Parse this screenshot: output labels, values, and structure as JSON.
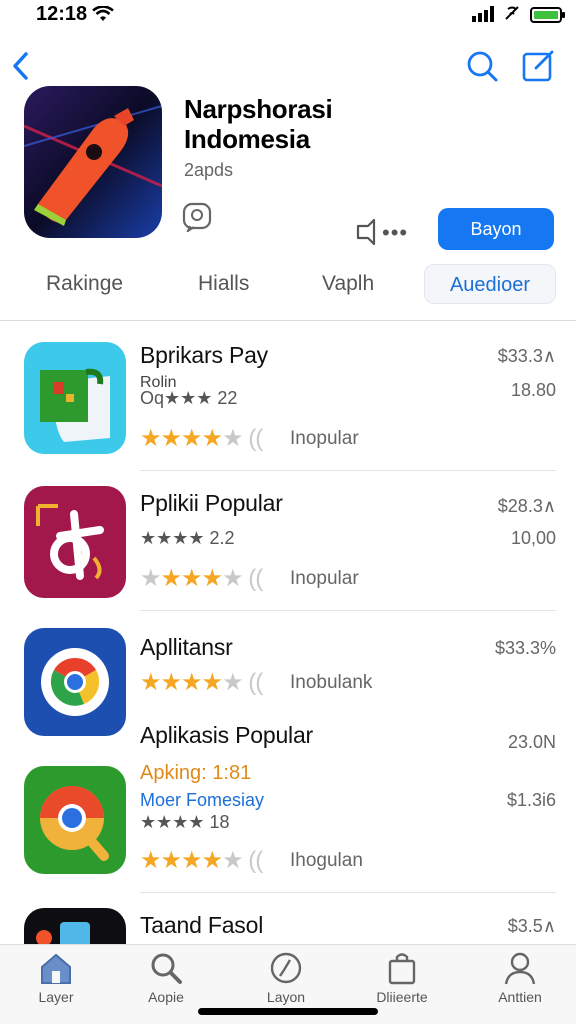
{
  "status_bar": {
    "time": "12:18"
  },
  "hero": {
    "title_line1": "Narpshorasi",
    "title_line2": "Indomesia",
    "subtitle": "2apds",
    "more": "•••",
    "get_label": "Bayon"
  },
  "tabs": [
    {
      "label": "Rakinge"
    },
    {
      "label": "Hialls"
    },
    {
      "label": "Vaplh"
    },
    {
      "label": "Auedioer"
    }
  ],
  "apps": [
    {
      "name": "Bprikars Pay",
      "sub1": "Rolin",
      "sub2": "Oq★★★ 22",
      "price1": "$33.3∧",
      "price2": "18.80",
      "rating_label": "Inopular",
      "full_stars": 4,
      "half": true,
      "stars_bold": "★★★★",
      "stars_tail": "★",
      "rating_prefix": "(( "
    },
    {
      "name": "Pplikii Popular",
      "sub2": "★★★★ 2.2",
      "price1": "$28.3∧",
      "price2": "10,00",
      "rating_label": "Inopular"
    },
    {
      "name": "Apllitansr",
      "price1": "$33.3%",
      "rating_label": "Inobulank"
    },
    {
      "name": "Aplikasis Popular",
      "sub_orange": "Apking: 1:81",
      "sub_blue": "Moer Fomesiay",
      "sub2": "★★★★ 18",
      "price1": "23.0N",
      "price2": "$1.3i6",
      "rating_label": "Ihogulan"
    },
    {
      "name": "Taand Fasol",
      "price1": "$3.5∧"
    }
  ],
  "tab_bar": [
    {
      "label": "Layer",
      "icon": "home-icon"
    },
    {
      "label": "Aopie",
      "icon": "search-icon"
    },
    {
      "label": "Layon",
      "icon": "compass-icon"
    },
    {
      "label": "Dliieerte",
      "icon": "bag-icon"
    },
    {
      "label": "Anttien",
      "icon": "person-icon"
    }
  ],
  "colors": {
    "accent": "#1677f2",
    "star": "#f5a623",
    "tab_active_text": "#1b6fd6"
  }
}
